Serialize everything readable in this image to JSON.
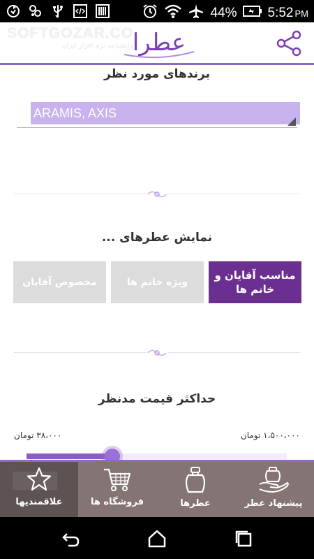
{
  "status_bar": {
    "battery_percent": "44%",
    "time": "5:52",
    "ampm": "PM",
    "left_icons": [
      "sync-icon",
      "share-hub-icon",
      "usb-icon",
      "code-icon",
      "barcode-icon"
    ],
    "right_icons": [
      "alarm-icon",
      "wifi-icon",
      "airplane-icon",
      "battery-icon"
    ]
  },
  "header": {
    "watermark_title": "SOFTGOZAR.COM",
    "watermark_subtitle": "دانشنامه نرم افزار ایران",
    "logo_text": "عطرا",
    "share_icon": "share-icon"
  },
  "brands": {
    "title": "برندهای مورد نظر",
    "selected": "ARAMIS, AXIS"
  },
  "show_for": {
    "title": "نمایش عطرهای ...",
    "options": [
      {
        "label": "مناسب آقایان و خانم ها",
        "selected": true
      },
      {
        "label": "ویژه خانم ها",
        "selected": false
      },
      {
        "label": "مخصوص آقایان",
        "selected": false
      }
    ]
  },
  "price": {
    "title": "حداکثر قیمت مدنظر",
    "min_label": "۳۸،۰۰۰ تومان",
    "max_label": "۱،۵۰۰،۰۰۰ تومان",
    "slider_fraction": 0.33
  },
  "bottom_nav": [
    {
      "label": "علاقمندیها",
      "icon": "star-icon",
      "active": true
    },
    {
      "label": "فروشگاه ها",
      "icon": "cart-icon",
      "active": false
    },
    {
      "label": "عطرها",
      "icon": "perfume-bottle-icon",
      "active": false
    },
    {
      "label": "پیشنهاد عطر",
      "icon": "hand-offer-icon",
      "active": false
    }
  ],
  "colors": {
    "accent": "#6a2f91",
    "brand_field": "#c8b3ee",
    "nav_bg": "#857474",
    "nav_active": "#5e5353"
  }
}
